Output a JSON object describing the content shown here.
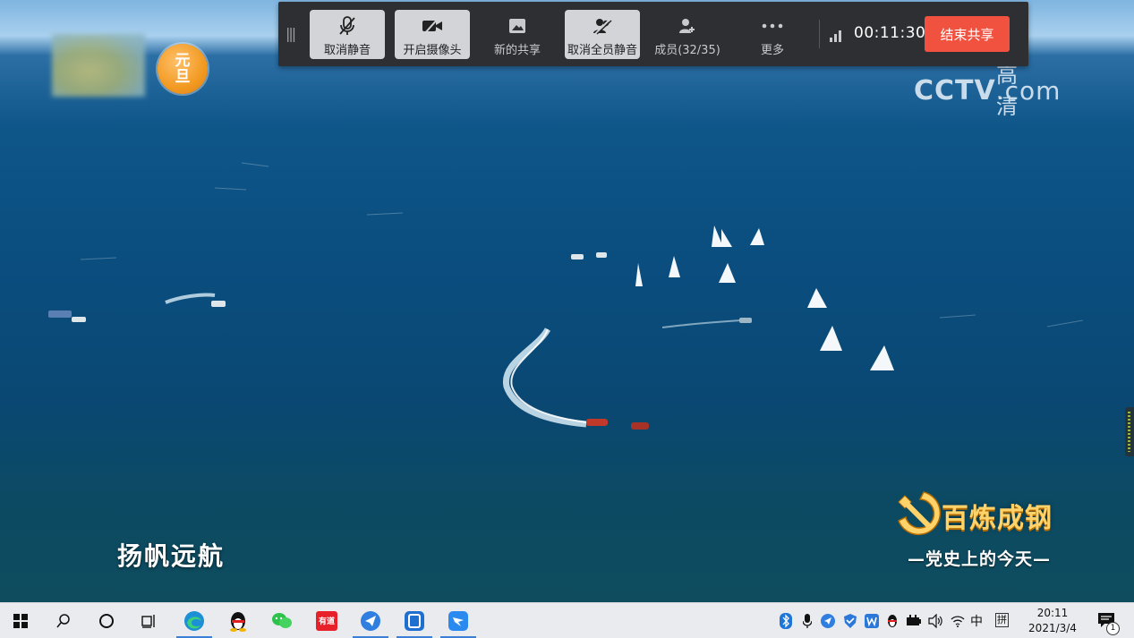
{
  "video": {
    "channel_badge": [
      "元",
      "旦"
    ],
    "cctv_hd": "高清",
    "cctv_brand": "CCTV",
    "cctv_com": ".com",
    "caption": "扬帆远航",
    "program_title": "百炼成钢",
    "program_subtitle": "—党史上的今天—"
  },
  "meeting_toolbar": {
    "unmute_label": "取消静音",
    "camera_label": "开启摄像头",
    "new_share_label": "新的共享",
    "unmute_all_label": "取消全员静音",
    "members_label": "成员(32/35)",
    "more_label": "更多",
    "elapsed_time": "00:11:30",
    "end_share_label": "结束共享"
  },
  "taskbar": {
    "apps": [
      "start",
      "search",
      "cortana",
      "task-view",
      "edge",
      "qq",
      "wechat",
      "youdao",
      "feishu",
      "tablet-app",
      "dingtalk"
    ],
    "app_text": {
      "youdao": "有道"
    },
    "tray": {
      "ime_lang": "中",
      "ime_mode": "拼",
      "time": "20:11",
      "date": "2021/3/4",
      "notification_count": "1"
    }
  },
  "colors": {
    "end_share": "#f0523f",
    "toolbar_bg": "#2d2f33",
    "sea": "#0a4d7e"
  }
}
